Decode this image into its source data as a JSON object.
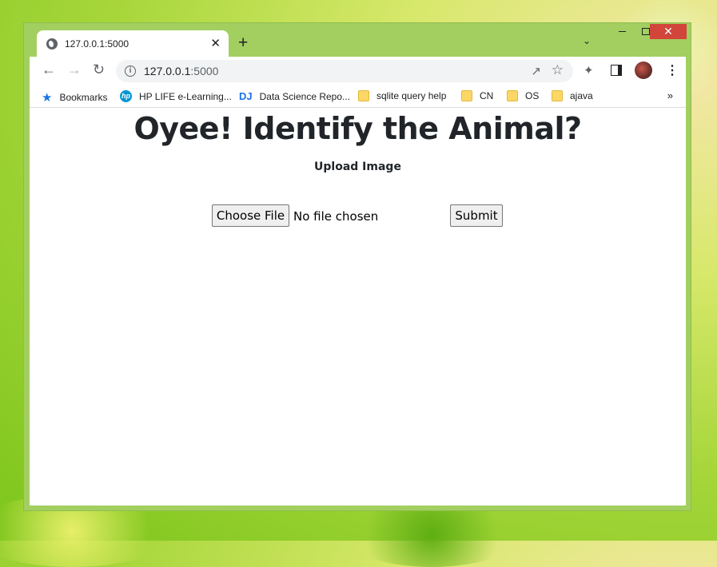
{
  "browser": {
    "tab_title": "127.0.0.1:5000",
    "url_host": "127.0.0.1",
    "url_port": ":5000",
    "new_tab_glyph": "+",
    "close_glyph": "✕"
  },
  "bookmarks": {
    "items": [
      {
        "label": "Bookmarks",
        "icon": "star-icon"
      },
      {
        "label": "HP LIFE e-Learning...",
        "icon": "hp-icon"
      },
      {
        "label": "Data Science Repo...",
        "icon": "dj-icon"
      },
      {
        "label": "sqlite query help",
        "icon": "folder-icon"
      },
      {
        "label": "CN",
        "icon": "folder-icon"
      },
      {
        "label": "OS",
        "icon": "folder-icon"
      },
      {
        "label": "ajava",
        "icon": "folder-icon"
      }
    ],
    "more": "»"
  },
  "page": {
    "title": "Oyee! Identify the Animal?",
    "upload_label": "Upload Image",
    "choose_file_label": "Choose File",
    "file_status": "No file chosen",
    "submit_label": "Submit"
  }
}
